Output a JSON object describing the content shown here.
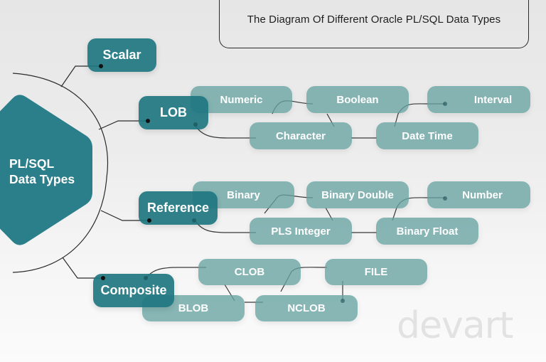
{
  "title": "The Diagram Of Different Oracle PL/SQL Data Types",
  "root": {
    "line1": "PL/SQL",
    "line2": "Data Types"
  },
  "categories": [
    {
      "label": "Scalar",
      "children": []
    },
    {
      "label": "LOB",
      "children": [
        "Numeric",
        "Boolean",
        "Interval",
        "Character",
        "Date Time"
      ]
    },
    {
      "label": "Reference",
      "children": [
        "Binary",
        "Binary Double",
        "Number",
        "PLS Integer",
        "Binary Float"
      ]
    },
    {
      "label": "Composite",
      "children": [
        "CLOB",
        "FILE",
        "BLOB",
        "NCLOB"
      ]
    }
  ],
  "watermark": "devart",
  "colors": {
    "primary_teal": "#2b7f8a",
    "secondary_teal": "#7fb3b2",
    "line": "#2a2a2a"
  }
}
